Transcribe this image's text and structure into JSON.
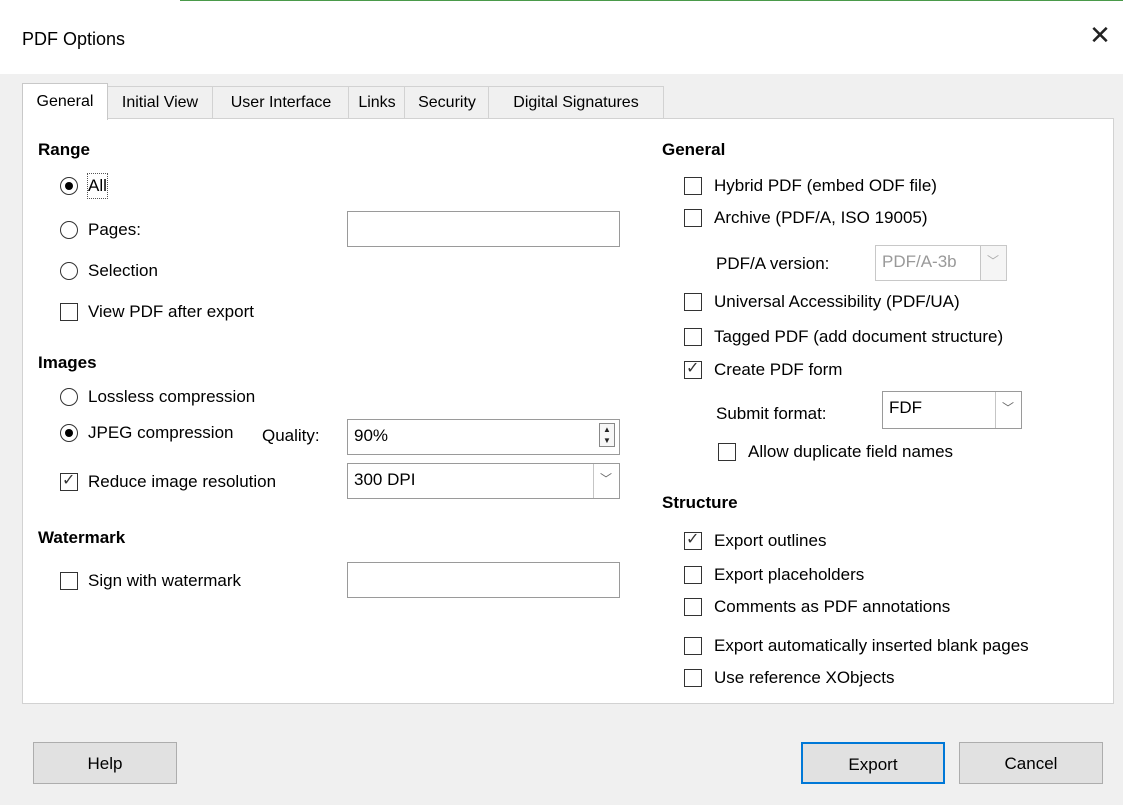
{
  "window": {
    "title": "PDF Options",
    "close_glyph": "✕"
  },
  "tabs": [
    {
      "label": "General",
      "active": true
    },
    {
      "label": "Initial View",
      "active": false
    },
    {
      "label": "User Interface",
      "active": false
    },
    {
      "label": "Links",
      "active": false
    },
    {
      "label": "Security",
      "active": false
    },
    {
      "label": "Digital Signatures",
      "active": false
    }
  ],
  "range": {
    "heading": "Range",
    "all_label": "All",
    "pages_label": "Pages:",
    "pages_value": "",
    "selection_label": "Selection",
    "view_pdf_label": "View PDF after export",
    "selected": "All",
    "view_pdf_checked": false
  },
  "images": {
    "heading": "Images",
    "lossless_label": "Lossless compression",
    "jpeg_label": "JPEG compression",
    "quality_label": "Quality:",
    "quality_value": "90%",
    "reduce_label": "Reduce image resolution",
    "reduce_checked": true,
    "resolution_value": "300 DPI",
    "selected": "JPEG compression"
  },
  "watermark": {
    "heading": "Watermark",
    "sign_label": "Sign with watermark",
    "sign_checked": false,
    "value": ""
  },
  "general": {
    "heading": "General",
    "hybrid_label": "Hybrid PDF (embed ODF file)",
    "archive_label": "Archive (PDF/A, ISO 19005)",
    "pdfa_version_label": "PDF/A version:",
    "pdfa_version_value": "PDF/A-3b",
    "ua_label": "Universal Accessibility (PDF/UA)",
    "tagged_label": "Tagged PDF (add document structure)",
    "form_label": "Create PDF form",
    "submit_format_label": "Submit format:",
    "submit_format_value": "FDF",
    "duplicate_label": "Allow duplicate field names",
    "checked": {
      "hybrid": false,
      "archive": false,
      "ua": false,
      "tagged": false,
      "form": true,
      "duplicate": false
    }
  },
  "structure": {
    "heading": "Structure",
    "outlines_label": "Export outlines",
    "placeholders_label": "Export placeholders",
    "comments_label": "Comments as PDF annotations",
    "blank_pages_label": "Export automatically inserted blank pages",
    "xobjects_label": "Use reference XObjects",
    "checked": {
      "outlines": true,
      "placeholders": false,
      "comments": false,
      "blank_pages": false,
      "xobjects": false
    }
  },
  "buttons": {
    "help": "Help",
    "export": "Export",
    "cancel": "Cancel"
  },
  "colors": {
    "accent": "#0078d7",
    "background": "#f0f0f0",
    "panel": "#ffffff"
  }
}
